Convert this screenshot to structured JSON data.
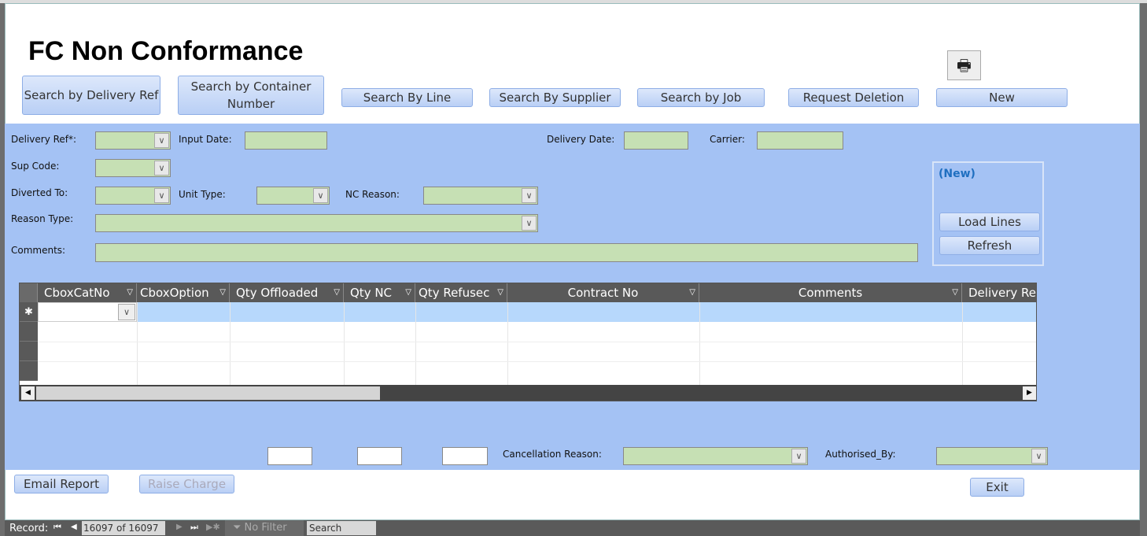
{
  "form": {
    "title": "FC Non Conformance"
  },
  "toolbar": {
    "search_delivery_ref": "Search by Delivery Ref",
    "search_container": "Search by Container Number",
    "search_line": "Search By Line",
    "search_supplier": "Search By Supplier",
    "search_job": "Search by Job",
    "request_deletion": "Request Deletion",
    "new": "New",
    "print_icon": "🖶"
  },
  "fields": {
    "delivery_ref": "Delivery Ref*:",
    "input_date": "Input Date:",
    "delivery_date": "Delivery Date:",
    "carrier": "Carrier:",
    "sup_code": "Sup Code:",
    "diverted_to": "Diverted To:",
    "unit_type": "Unit Type:",
    "nc_reason": "NC Reason:",
    "reason_type": "Reason Type:",
    "comments": "Comments:"
  },
  "panel": {
    "status": "(New)",
    "load_lines": "Load Lines",
    "refresh": "Refresh"
  },
  "grid": {
    "columns": [
      "CboxCatNo",
      "CboxOption",
      "Qty Offloaded",
      "Qty NC",
      "Qty Refusec",
      "Contract No",
      "Comments",
      "Delivery Re"
    ],
    "new_row_marker": "✱"
  },
  "footer": {
    "cancellation_reason": "Cancellation  Reason:",
    "authorised_by": "Authorised_By:",
    "email_report": "Email Report",
    "raise_charge": "Raise Charge",
    "exit": "Exit"
  },
  "status": {
    "record_label": "Record:",
    "record_value": "16097 of 16097",
    "filter": "No Filter",
    "search": "Search"
  }
}
